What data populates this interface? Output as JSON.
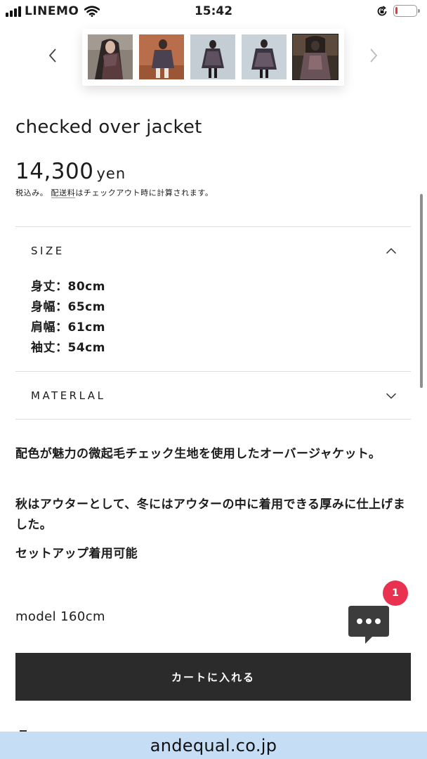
{
  "status_bar": {
    "carrier": "LINEMO",
    "time": "15:42",
    "battery_level": 0.12,
    "icons": [
      "signal-icon",
      "wifi-icon",
      "rotation-lock-icon",
      "battery-icon"
    ]
  },
  "gallery": {
    "thumbnails": [
      {
        "label": "thumbnail-1",
        "selected": false
      },
      {
        "label": "thumbnail-2",
        "selected": false
      },
      {
        "label": "thumbnail-3",
        "selected": false
      },
      {
        "label": "thumbnail-4",
        "selected": false
      },
      {
        "label": "thumbnail-5",
        "selected": true
      }
    ],
    "prev_icon": "chevron-left-icon",
    "next_icon": "chevron-right-icon"
  },
  "product": {
    "title": "checked over jacket",
    "price": "14,300",
    "currency": "yen",
    "tax_prefix": "税込み。",
    "shipping_link": "配送料",
    "tax_suffix": "はチェックアウト時に計算されます。"
  },
  "accordions": {
    "size": {
      "label": "SIZE",
      "expanded": true,
      "lines": [
        "身丈：80cm",
        "身幅：65cm",
        "肩幅：61cm",
        "袖丈：54cm"
      ]
    },
    "material": {
      "label": "MATERLAL",
      "expanded": false
    }
  },
  "description": {
    "paragraphs": [
      "配色が魅力の微起毛チェック生地を使用したオーバージャケット。",
      "秋はアウターとして、冬にはアウターの中に着用できる厚みに仕上げました。",
      "セットアップ着用可能"
    ],
    "model": "model 160cm"
  },
  "chat": {
    "badge_count": "1",
    "icon": "chat-bubble-icon"
  },
  "cart_button": "カートに入れる",
  "footer": {
    "domain": "andequal.co.jp"
  },
  "colors": {
    "button_bg": "#2b2b2b",
    "badge": "#e8324f",
    "footer_bg": "#c6ddf6",
    "battery_low": "#e5383b"
  }
}
